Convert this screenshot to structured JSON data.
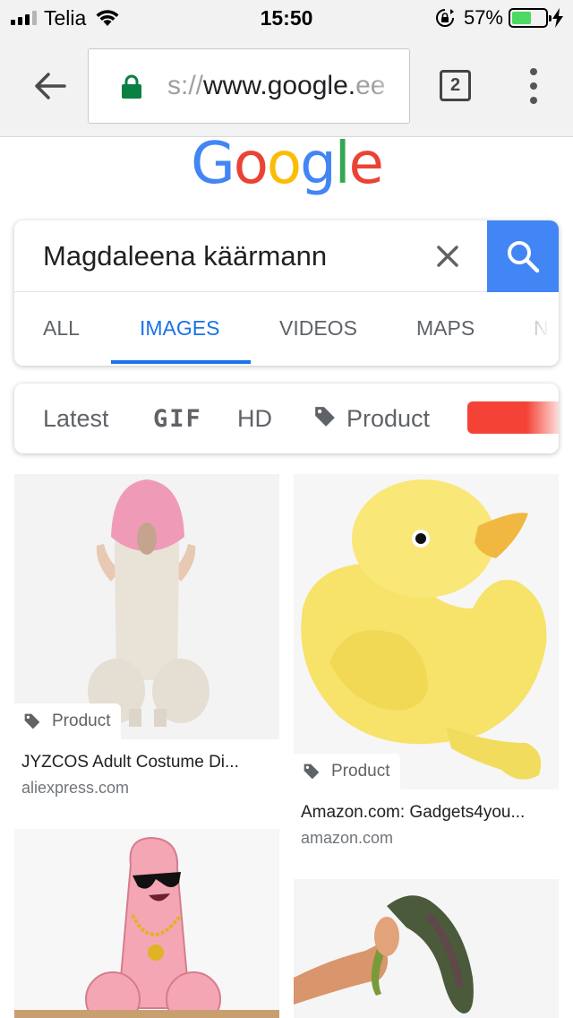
{
  "status_bar": {
    "carrier": "Telia",
    "time": "15:50",
    "battery_percent": "57%",
    "battery_level": 0.57
  },
  "browser": {
    "url_prefix": "s://",
    "url_main": "www.google.",
    "url_suffix": "ee",
    "tab_count": "2"
  },
  "logo": {
    "letters": [
      "G",
      "o",
      "o",
      "g",
      "l",
      "e"
    ],
    "colors": [
      "#4285f4",
      "#ea4335",
      "#fbbc05",
      "#4285f4",
      "#34a853",
      "#ea4335"
    ]
  },
  "search": {
    "query": "Magdaleena käärmann",
    "accent_color": "#4285f4"
  },
  "search_tabs": [
    {
      "label": "ALL"
    },
    {
      "label": "IMAGES",
      "active": true
    },
    {
      "label": "VIDEOS"
    },
    {
      "label": "MAPS"
    },
    {
      "label": "NE"
    }
  ],
  "filters": {
    "latest": "Latest",
    "gif": "GIF",
    "hd": "HD",
    "product": "Product",
    "color_chip": "#f44336"
  },
  "results": [
    {
      "badge": "Product",
      "title": "JYZCOS Adult Costume Di...",
      "source": "aliexpress.com"
    },
    {
      "badge": "Product",
      "title": "Amazon.com: Gadgets4you...",
      "source": "amazon.com"
    },
    {
      "badge": "",
      "title": "",
      "source": ""
    },
    {
      "badge": "",
      "title": "",
      "source": ""
    }
  ]
}
